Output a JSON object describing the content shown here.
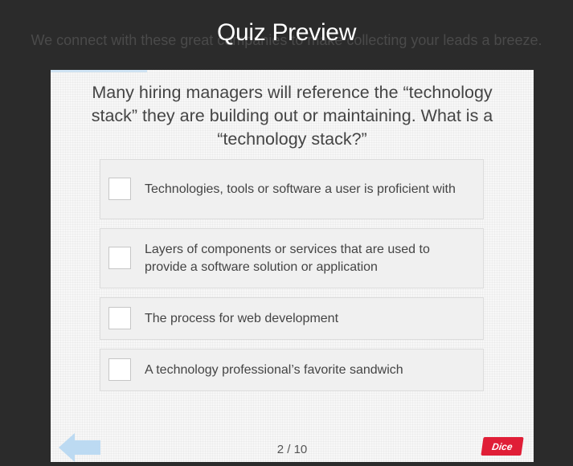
{
  "background": {
    "text": "We connect with these great companies to make collecting your leads a breeze."
  },
  "modal": {
    "title": "Quiz Preview"
  },
  "quiz": {
    "progress_fraction": 0.2,
    "question": "Many hiring managers will reference the “technology stack” they are building out or maintaining. What is a “technology stack?”",
    "options": [
      {
        "label": "Technologies, tools or software a user is proficient with",
        "checked": false
      },
      {
        "label": "Layers of components or services that are used to provide a software solution or application",
        "checked": false
      },
      {
        "label": "The process for web development",
        "checked": false
      },
      {
        "label": "A technology professional’s favorite sandwich",
        "checked": false
      }
    ],
    "page_indicator": "2 / 10",
    "back_icon": "arrow-left-icon",
    "brand": "Dice"
  },
  "colors": {
    "overlay": "#2b2b2b",
    "card": "#f7f7f7",
    "option_bg": "#f0f0f0",
    "arrow": "#bcdaf2",
    "brand": "#e01e37"
  }
}
